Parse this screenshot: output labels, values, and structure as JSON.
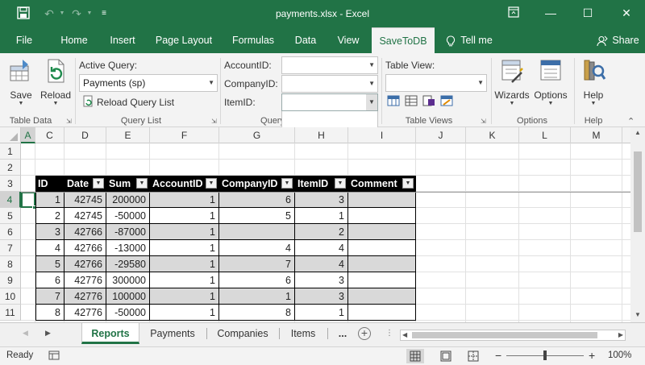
{
  "window": {
    "title": "payments.xlsx  -  Excel",
    "minimize_glyph": "—",
    "maximize_glyph": "☐",
    "close_glyph": "✕"
  },
  "tabs": [
    "File",
    "Home",
    "Insert",
    "Page Layout",
    "Formulas",
    "Data",
    "View",
    "SaveToDB",
    "Tell me",
    "Share"
  ],
  "ribbon": {
    "save_label": "Save",
    "reload_label": "Reload",
    "group_table_data": "Table Data",
    "active_query_label": "Active Query:",
    "active_query_value": "Payments (sp)",
    "reload_query_list": "Reload Query List",
    "group_query_list": "Query List",
    "account_label": "AccountID:",
    "company_label": "CompanyID:",
    "item_label": "ItemID:",
    "group_query": "Query",
    "table_view_label": "Table View:",
    "group_table_views": "Table Views",
    "wizards_label": "Wizards",
    "options_label": "Options",
    "group_options": "Options",
    "help_label": "Help",
    "group_help": "Help"
  },
  "columns": [
    "A",
    "C",
    "D",
    "E",
    "F",
    "G",
    "H",
    "I",
    "J",
    "K",
    "L",
    "M"
  ],
  "rows": [
    "1",
    "2",
    "3",
    "4",
    "5",
    "6",
    "7",
    "8",
    "9",
    "10",
    "11"
  ],
  "table": {
    "headers": [
      "ID",
      "Date",
      "Sum",
      "AccountID",
      "CompanyID",
      "ItemID",
      "Comment"
    ],
    "rows": [
      [
        "1",
        "42745",
        "200000",
        "1",
        "6",
        "3",
        ""
      ],
      [
        "2",
        "42745",
        "-50000",
        "1",
        "5",
        "1",
        ""
      ],
      [
        "3",
        "42766",
        "-87000",
        "1",
        "",
        "2",
        ""
      ],
      [
        "4",
        "42766",
        "-13000",
        "1",
        "4",
        "4",
        ""
      ],
      [
        "5",
        "42766",
        "-29580",
        "1",
        "7",
        "4",
        ""
      ],
      [
        "6",
        "42776",
        "300000",
        "1",
        "6",
        "3",
        ""
      ],
      [
        "7",
        "42776",
        "100000",
        "1",
        "1",
        "3",
        ""
      ],
      [
        "8",
        "42776",
        "-50000",
        "1",
        "8",
        "1",
        ""
      ]
    ]
  },
  "sheets": [
    "Reports",
    "Payments",
    "Companies",
    "Items",
    "..."
  ],
  "status": {
    "ready": "Ready",
    "zoom": "100%"
  }
}
